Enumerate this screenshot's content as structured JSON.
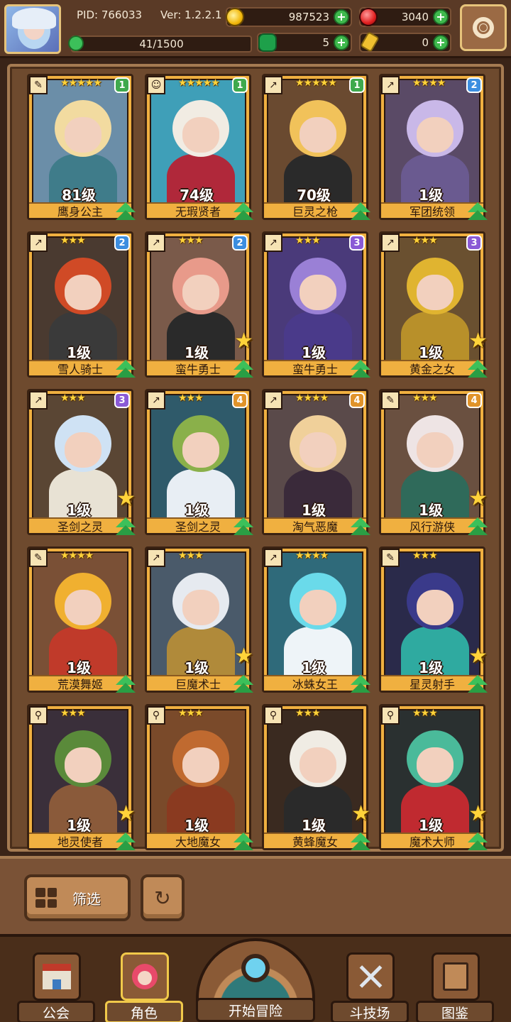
{
  "hud": {
    "pid": "PID: 766033",
    "version": "Ver: 1.2.2.1",
    "gold": "987523",
    "gems": "3040",
    "energy": "41/1500",
    "energy_fraction": 0.027,
    "clover": "5",
    "keys": "0",
    "plus": "+"
  },
  "heroes": [
    {
      "name": "鹰身公主",
      "level": "81级",
      "stars": "★★★★★",
      "rank": "1",
      "rank_class": "r1",
      "class_icon": "✎",
      "big_star": false,
      "art": "#6b8ea8",
      "hair": "#f2dba0",
      "outfit": "#3f7c8a"
    },
    {
      "name": "无瑕贤者",
      "level": "74级",
      "stars": "★★★★★",
      "rank": "1",
      "rank_class": "r1",
      "class_icon": "☺",
      "big_star": false,
      "art": "#3f9fb8",
      "hair": "#f1ece3",
      "outfit": "#b0283a"
    },
    {
      "name": "巨灵之枪",
      "level": "70级",
      "stars": "★★★★★",
      "rank": "1",
      "rank_class": "r1",
      "class_icon": "↗",
      "big_star": false,
      "art": "#6a4a30",
      "hair": "#f1c25a",
      "outfit": "#2a2a2a"
    },
    {
      "name": "军团统领",
      "level": "1级",
      "stars": "★★★★",
      "rank": "2",
      "rank_class": "r2",
      "class_icon": "↗",
      "big_star": false,
      "art": "#5a4a66",
      "hair": "#c9b8e8",
      "outfit": "#6a5a90"
    },
    {
      "name": "雪人骑士",
      "level": "1级",
      "stars": "★★★",
      "rank": "2",
      "rank_class": "r2",
      "class_icon": "↗",
      "big_star": false,
      "art": "#4a3a30",
      "hair": "#d04a26",
      "outfit": "#3a3a3a"
    },
    {
      "name": "蛮牛勇士",
      "level": "1级",
      "stars": "★★★",
      "rank": "2",
      "rank_class": "r2",
      "class_icon": "↗",
      "big_star": true,
      "art": "#7a5a4a",
      "hair": "#e89a8a",
      "outfit": "#2a2a2a"
    },
    {
      "name": "蛮牛勇士",
      "level": "1级",
      "stars": "★★★",
      "rank": "3",
      "rank_class": "r3",
      "class_icon": "↗",
      "big_star": false,
      "art": "#4a3a7a",
      "hair": "#9a80d6",
      "outfit": "#4a3a8a"
    },
    {
      "name": "黄金之女",
      "level": "1级",
      "stars": "★★★",
      "rank": "3",
      "rank_class": "r3",
      "class_icon": "↗",
      "big_star": true,
      "art": "#6a5030",
      "hair": "#e0b430",
      "outfit": "#b8902a"
    },
    {
      "name": "圣剑之灵",
      "level": "1级",
      "stars": "★★★",
      "rank": "3",
      "rank_class": "r3",
      "class_icon": "↗",
      "big_star": true,
      "art": "#5a4634",
      "hair": "#cfe2f4",
      "outfit": "#e8e2d4"
    },
    {
      "name": "圣剑之灵",
      "level": "1级",
      "stars": "★★★",
      "rank": "4",
      "rank_class": "r4",
      "class_icon": "↗",
      "big_star": false,
      "art": "#2f5a6a",
      "hair": "#8ab04a",
      "outfit": "#e8eef4"
    },
    {
      "name": "淘气恶魔",
      "level": "1级",
      "stars": "★★★★",
      "rank": "4",
      "rank_class": "r4",
      "class_icon": "↗",
      "big_star": false,
      "art": "#5a4a4a",
      "hair": "#f0d09a",
      "outfit": "#3a2a3a"
    },
    {
      "name": "风行游侠",
      "level": "1级",
      "stars": "★★★",
      "rank": "4",
      "rank_class": "r4",
      "class_icon": "✎",
      "big_star": true,
      "art": "#6a5040",
      "hair": "#eee4e4",
      "outfit": "#2f6a5a"
    },
    {
      "name": "荒漠舞姬",
      "level": "1级",
      "stars": "★★★★",
      "rank": "",
      "rank_class": "",
      "class_icon": "✎",
      "big_star": false,
      "art": "#7a5036",
      "hair": "#f0b030",
      "outfit": "#c03a2a"
    },
    {
      "name": "巨魔术士",
      "level": "1级",
      "stars": "★★★",
      "rank": "",
      "rank_class": "",
      "class_icon": "↗",
      "big_star": true,
      "art": "#4a5a6a",
      "hair": "#e6eaf0",
      "outfit": "#b08a3a"
    },
    {
      "name": "冰蛛女王",
      "level": "1级",
      "stars": "★★★★",
      "rank": "",
      "rank_class": "",
      "class_icon": "↗",
      "big_star": false,
      "art": "#2f6a7a",
      "hair": "#6adaea",
      "outfit": "#eef4f8"
    },
    {
      "name": "星灵射手",
      "level": "1级",
      "stars": "★★★",
      "rank": "",
      "rank_class": "",
      "class_icon": "✎",
      "big_star": true,
      "art": "#2a2a4a",
      "hair": "#3a3a8a",
      "outfit": "#2faaa0"
    },
    {
      "name": "地灵使者",
      "level": "1级",
      "stars": "★★★",
      "rank": "",
      "rank_class": "",
      "class_icon": "⚲",
      "big_star": true,
      "art": "#3a2f3a",
      "hair": "#5a8a3a",
      "outfit": "#8a5a3a"
    },
    {
      "name": "大地魔女",
      "level": "1级",
      "stars": "★★★",
      "rank": "",
      "rank_class": "",
      "class_icon": "⚲",
      "big_star": false,
      "art": "#7a4a2a",
      "hair": "#c06a30",
      "outfit": "#8a3a20"
    },
    {
      "name": "黄蜂魔女",
      "level": "1级",
      "stars": "★★★",
      "rank": "",
      "rank_class": "",
      "class_icon": "⚲",
      "big_star": true,
      "art": "#3a2a20",
      "hair": "#f0ece4",
      "outfit": "#2a2a2a"
    },
    {
      "name": "魔术大师",
      "level": "1级",
      "stars": "★★★",
      "rank": "",
      "rank_class": "",
      "class_icon": "⚲",
      "big_star": true,
      "art": "#2a3030",
      "hair": "#4aba9a",
      "outfit": "#c02a30"
    }
  ],
  "filter": {
    "label": "筛选",
    "reset_icon": "↻"
  },
  "nav": {
    "guild": "公会",
    "heroes": "角色",
    "adventure": "开始冒险",
    "arena": "斗技场",
    "codex": "图鉴"
  }
}
